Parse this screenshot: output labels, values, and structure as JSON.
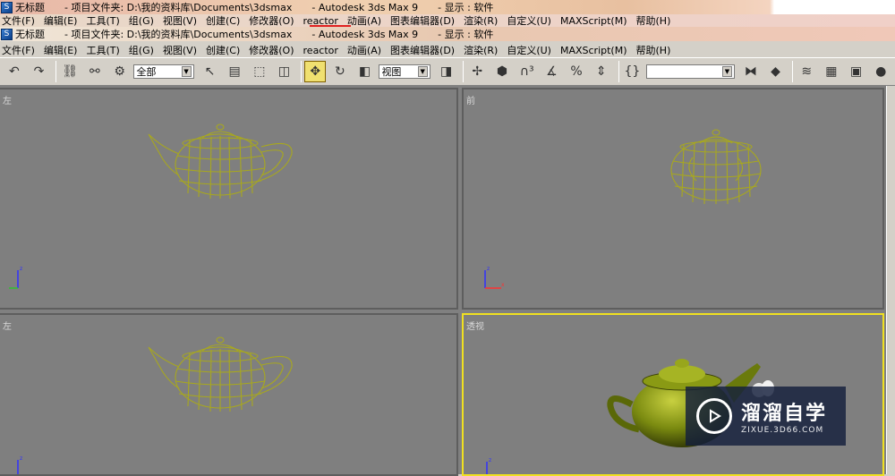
{
  "title_bar_1": {
    "icon_glyph": "S",
    "doc": "无标题",
    "folder": "- 项目文件夹: D:\\我的资料库\\Documents\\3dsmax",
    "app": "- Autodesk 3ds Max 9",
    "display": "- 显示 : 软件"
  },
  "title_bar_2": {
    "icon_glyph": "S",
    "doc": "无标题",
    "folder": "- 项目文件夹: D:\\我的资料库\\Documents\\3dsmax",
    "app": "- Autodesk 3ds Max 9",
    "display": "- 显示 : 软件"
  },
  "menu_1": [
    "文件(F)",
    "编辑(E)",
    "工具(T)",
    "组(G)",
    "视图(V)",
    "创建(C)",
    "修改器(O)",
    "reactor",
    "动画(A)",
    "图表编辑器(D)",
    "渲染(R)",
    "自定义(U)",
    "MAXScript(M)",
    "帮助(H)"
  ],
  "menu_2": [
    "文件(F)",
    "编辑(E)",
    "工具(T)",
    "组(G)",
    "视图(V)",
    "创建(C)",
    "修改器(O)",
    "reactor",
    "动画(A)",
    "图表编辑器(D)",
    "渲染(R)",
    "自定义(U)",
    "MAXScript(M)",
    "帮助(H)"
  ],
  "toolbar": {
    "selection_filter": "全部",
    "coord_system": "视图",
    "named_selection": ""
  },
  "viewports": {
    "top_left": "左",
    "top_right": "前",
    "bottom_left": "左",
    "bottom_right": "透视"
  },
  "watermark": {
    "title": "溜溜自学",
    "subtitle": "ZIXUE.3D66.COM"
  },
  "colors": {
    "wireframe": "#a8a81e",
    "active_border": "#f0e020",
    "viewport_bg": "#7f7f7f",
    "teapot_shaded": "#7a8a10"
  }
}
